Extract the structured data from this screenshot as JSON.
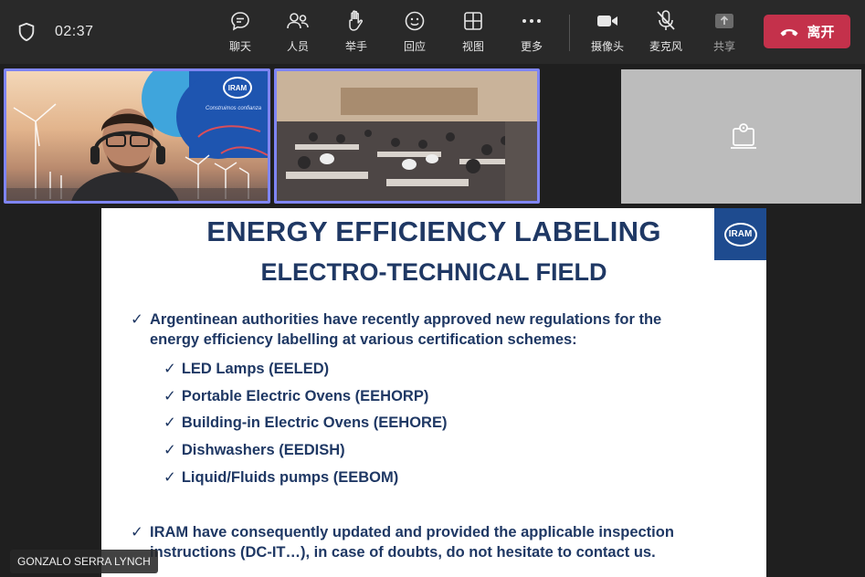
{
  "topbar": {
    "timer": "02:37",
    "buttons": {
      "chat": "聊天",
      "people": "人员",
      "raise_hand": "举手",
      "react": "回应",
      "view": "视图",
      "more": "更多",
      "camera": "摄像头",
      "mic": "麦克风",
      "share": "共享"
    },
    "leave_label": "离开",
    "colors": {
      "leave": "#c4314b",
      "active_tile_border": "#7f85f5"
    }
  },
  "tiles": {
    "presenter_logo": "IRAM",
    "presenter_tagline": "Construimos confianza"
  },
  "slide": {
    "logo": "IRAM",
    "title_line1": "ENERGY EFFICIENCY LABELING",
    "title_line2": "ELECTRO-TECHNICAL FIELD",
    "checkmark": "✓",
    "bullet1_line1": "Argentinean authorities have recently approved new regulations for the",
    "bullet1_line2": "energy efficiency labelling at various certification schemes:",
    "items": [
      "LED Lamps (EELED)",
      "Portable Electric Ovens (EEHORP)",
      "Building-in Electric Ovens (EEHORE)",
      "Dishwashers (EEDISH)",
      "Liquid/Fluids pumps (EEBOM)"
    ],
    "bullet2_line1": "IRAM have consequently updated and provided the applicable inspection",
    "bullet2_line2": "instructions (DC-IT…), in case of doubts, do not hesitate to contact us.",
    "colors": {
      "text": "#1f3864",
      "logo_bg": "#1e4b8f"
    }
  },
  "speaker_name": "GONZALO SERRA LYNCH"
}
